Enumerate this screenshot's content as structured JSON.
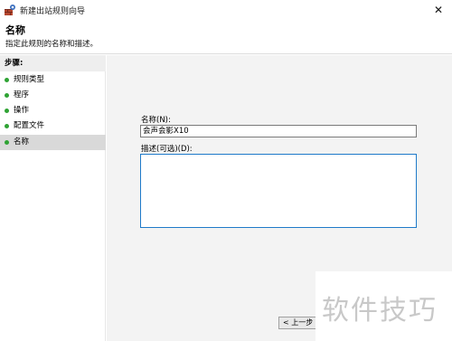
{
  "window": {
    "title": "新建出站规则向导",
    "close_glyph": "✕"
  },
  "header": {
    "title": "名称",
    "description": "指定此规则的名称和描述。"
  },
  "sidebar": {
    "steps_title": "步骤:",
    "items": [
      {
        "label": "规则类型",
        "active": false
      },
      {
        "label": "程序",
        "active": false
      },
      {
        "label": "操作",
        "active": false
      },
      {
        "label": "配置文件",
        "active": false
      },
      {
        "label": "名称",
        "active": true
      }
    ]
  },
  "form": {
    "name_label": "名称(N):",
    "name_value": "会声会影X10",
    "desc_label": "描述(可选)(D):",
    "desc_value": ""
  },
  "footer": {
    "prev_label": "< 上一步"
  },
  "watermark": {
    "text": "软件技巧"
  },
  "colors": {
    "step_dot": "#2fa334",
    "active_border": "#1f7ac9"
  }
}
